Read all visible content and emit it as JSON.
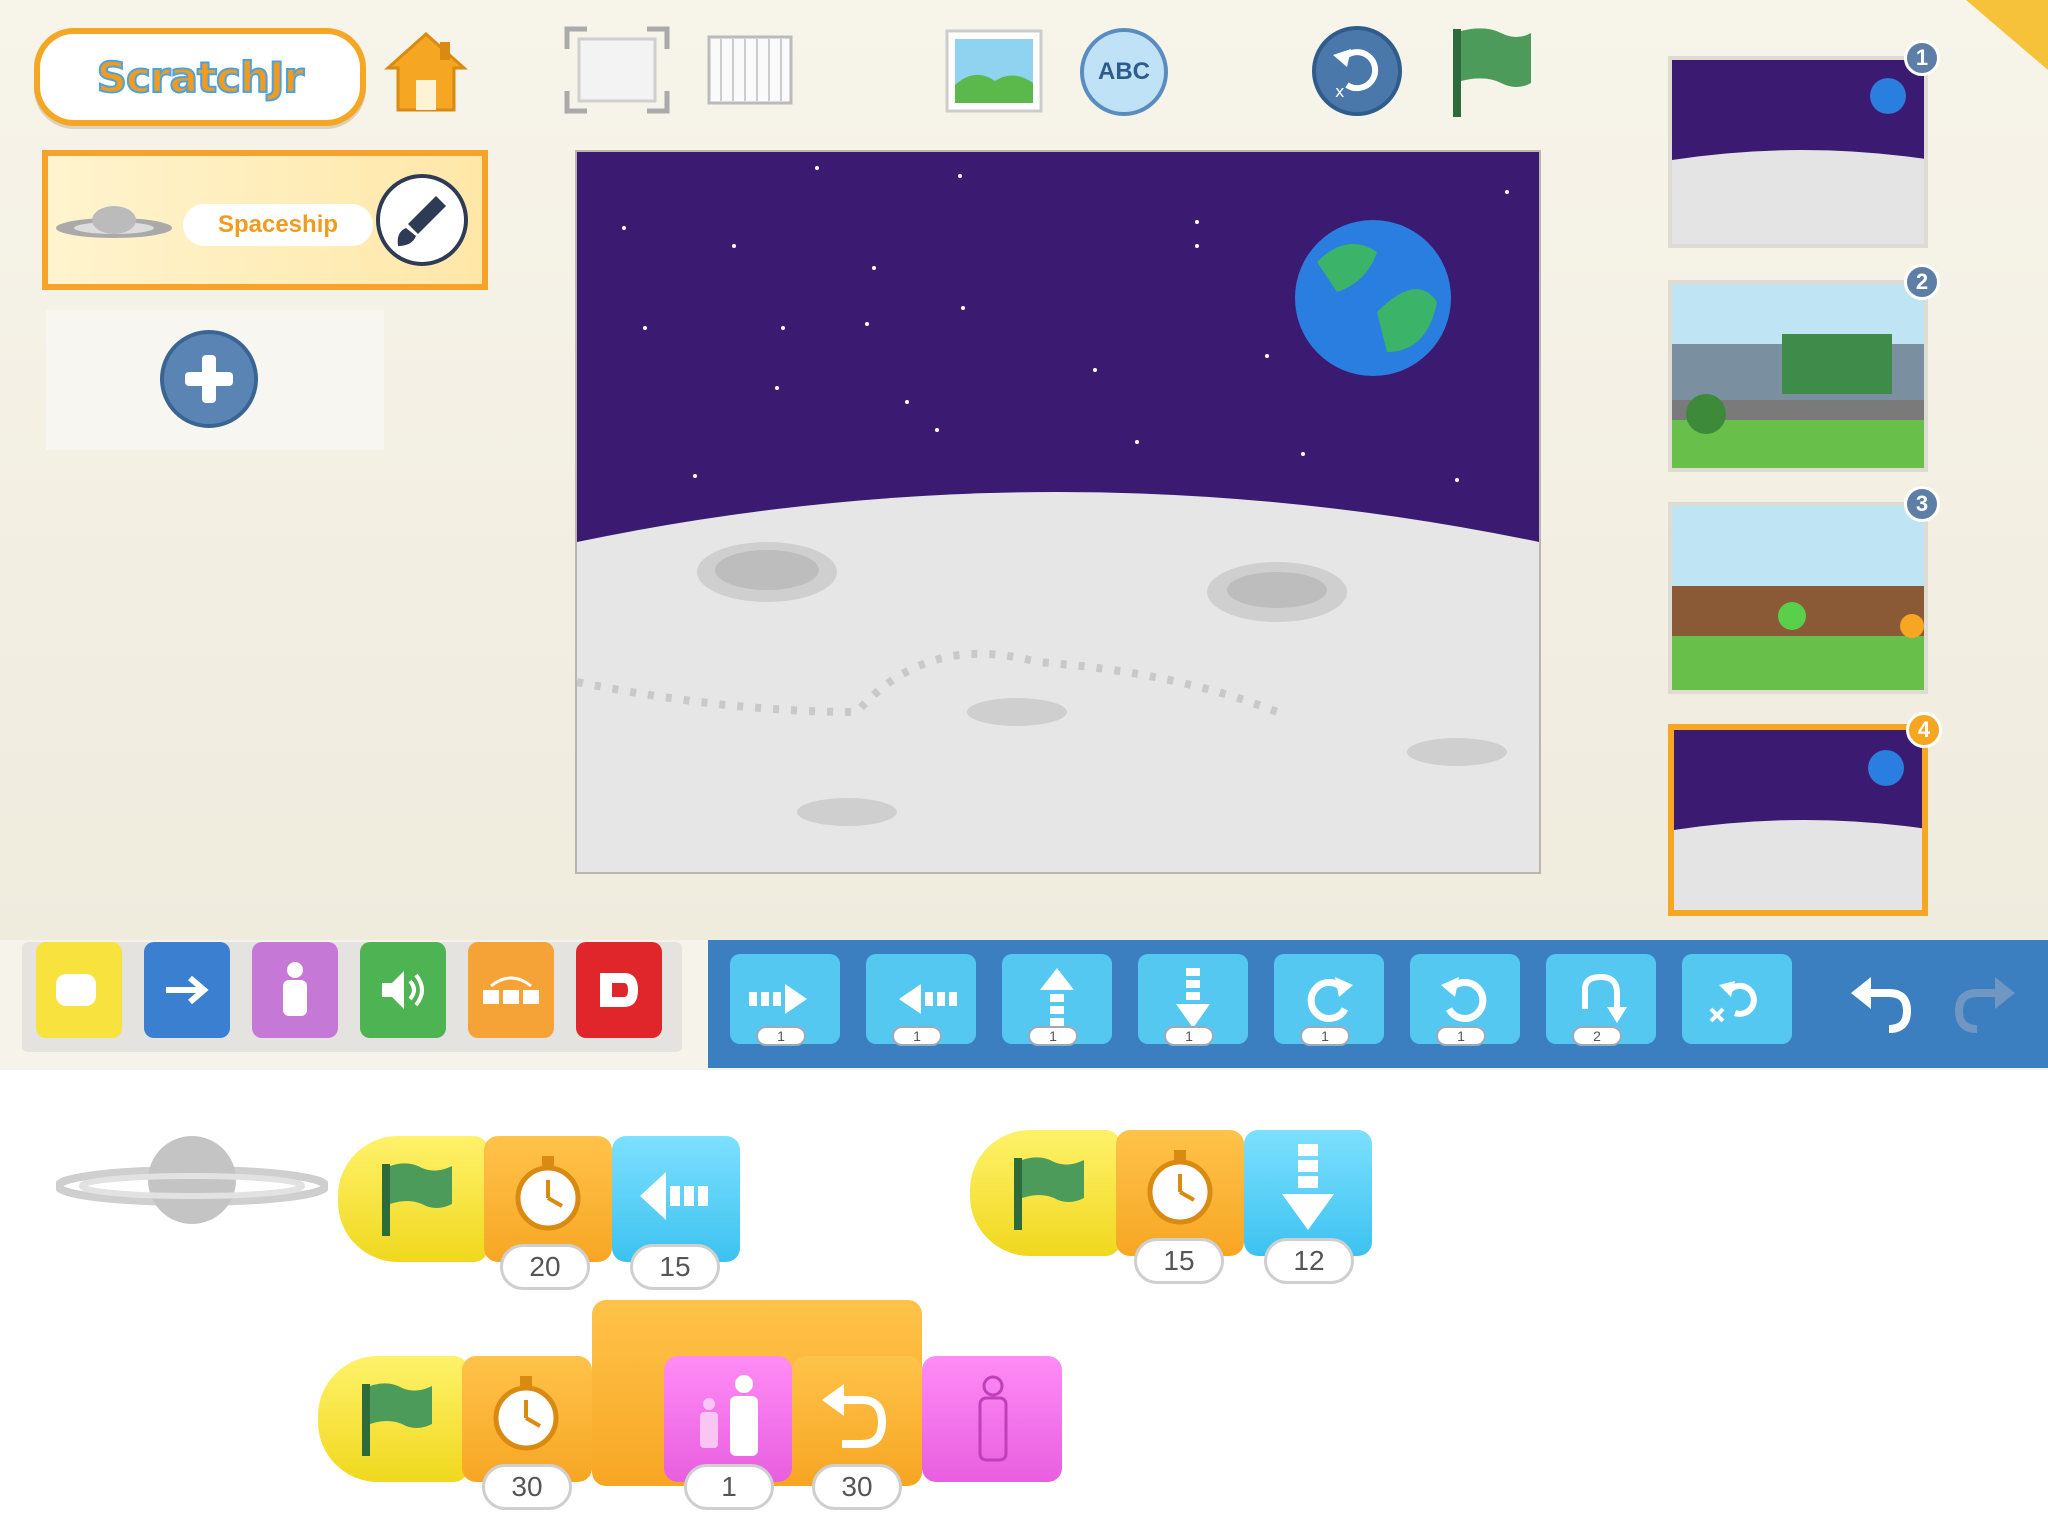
{
  "app": {
    "logo_text": "ScratchJr"
  },
  "toolbar": {
    "home_icon": "home-icon",
    "fullscreen_icon": "fullscreen-icon",
    "grid_icon": "grid-icon",
    "background_icon": "background-icon",
    "text_icon_label": "ABC",
    "reset_icon": "reset-characters-icon",
    "green_flag_icon": "green-flag-icon"
  },
  "sprites": {
    "items": [
      {
        "name": "Spaceship",
        "selected": true
      }
    ],
    "add_icon": "plus-icon"
  },
  "pages": [
    {
      "number": "1",
      "selected": false,
      "scene": "moon"
    },
    {
      "number": "2",
      "selected": false,
      "scene": "neighborhood"
    },
    {
      "number": "3",
      "selected": false,
      "scene": "backyard"
    },
    {
      "number": "4",
      "selected": true,
      "scene": "moon"
    }
  ],
  "categories": [
    {
      "name": "triggering",
      "color": "#f7e23e"
    },
    {
      "name": "motion",
      "color": "#3a7fd0"
    },
    {
      "name": "looks",
      "color": "#c678d6"
    },
    {
      "name": "sound",
      "color": "#4db353"
    },
    {
      "name": "control",
      "color": "#f5a336"
    },
    {
      "name": "end",
      "color": "#e0252b"
    }
  ],
  "palette": {
    "blocks": [
      {
        "name": "move-right",
        "value": "1"
      },
      {
        "name": "move-left",
        "value": "1"
      },
      {
        "name": "move-up",
        "value": "1"
      },
      {
        "name": "move-down",
        "value": "1"
      },
      {
        "name": "turn-right",
        "value": "1"
      },
      {
        "name": "turn-left",
        "value": "1"
      },
      {
        "name": "hop",
        "value": "2"
      },
      {
        "name": "go-home",
        "value": ""
      }
    ],
    "undo_icon": "undo-icon",
    "redo_icon": "redo-icon"
  },
  "scripts": [
    {
      "blocks": [
        "green-flag",
        "wait",
        "move-left"
      ],
      "values": [
        "",
        "20",
        "15"
      ]
    },
    {
      "blocks": [
        "green-flag",
        "wait",
        "move-down"
      ],
      "values": [
        "",
        "15",
        "12"
      ]
    },
    {
      "blocks": [
        "green-flag",
        "wait",
        "repeat",
        "shrink",
        "turn-left",
        "reset-size"
      ],
      "values": [
        "",
        "30",
        "",
        "1",
        "30",
        ""
      ]
    }
  ],
  "colors": {
    "accent": "#f5a623",
    "palette_bg": "#3b7fc0",
    "stage_sky": "#3b1a72",
    "moon": "#e4e4e4"
  }
}
